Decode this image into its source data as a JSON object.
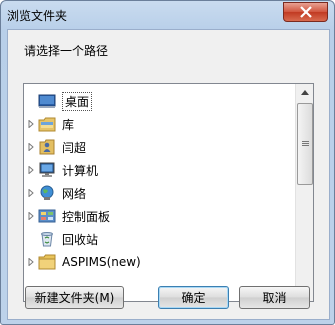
{
  "window": {
    "title": "浏览文件夹"
  },
  "dialog": {
    "prompt": "请选择一个路径"
  },
  "tree": {
    "items": [
      {
        "label": "桌面",
        "icon": "desktop-icon"
      },
      {
        "label": "库",
        "icon": "library-folder-icon"
      },
      {
        "label": "闫超",
        "icon": "user-folder-icon"
      },
      {
        "label": "计算机",
        "icon": "computer-icon"
      },
      {
        "label": "网络",
        "icon": "network-icon"
      },
      {
        "label": "控制面板",
        "icon": "control-panel-icon"
      },
      {
        "label": "回收站",
        "icon": "recycle-bin-icon"
      },
      {
        "label": "ASPIMS(new)",
        "icon": "folder-icon"
      }
    ]
  },
  "buttons": {
    "new_folder": "新建文件夹(M)",
    "ok": "确定",
    "cancel": "取消"
  }
}
